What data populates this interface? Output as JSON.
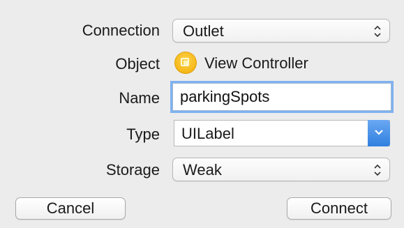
{
  "form": {
    "connection": {
      "label": "Connection",
      "value": "Outlet"
    },
    "object": {
      "label": "Object",
      "value": "View Controller",
      "icon": "view-controller-icon"
    },
    "name": {
      "label": "Name",
      "value": "parkingSpots"
    },
    "type": {
      "label": "Type",
      "value": "UILabel"
    },
    "storage": {
      "label": "Storage",
      "value": "Weak"
    }
  },
  "buttons": {
    "cancel_label": "Cancel",
    "connect_label": "Connect"
  },
  "colors": {
    "background": "#ececec",
    "focus_ring": "#7fb2f0",
    "combo_button": "#3a86e6",
    "object_icon": "#f5b800"
  }
}
